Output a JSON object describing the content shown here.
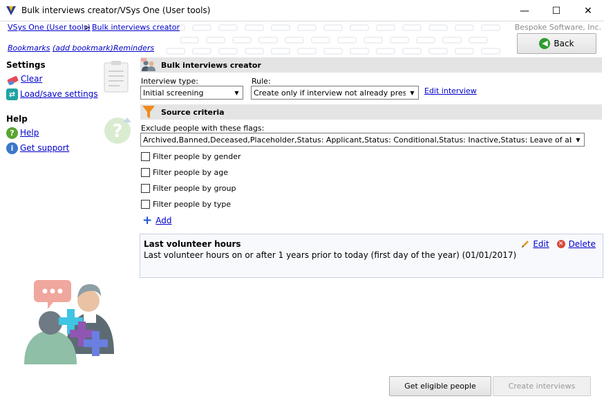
{
  "window": {
    "title": "Bulk interviews creator/VSys One (User tools)",
    "minimize": "—",
    "maximize": "☐",
    "close": "✕"
  },
  "breadcrumb": {
    "home": "VSys One (User tools)",
    "separator": ">",
    "current": "Bulk interviews creator"
  },
  "company": "Bespoke Software, Inc.",
  "back_label": "Back",
  "top_links": {
    "bookmarks": "Bookmarks",
    "add_bookmark": "(add bookmark)",
    "reminders": "Reminders"
  },
  "sidebar": {
    "settings_heading": "Settings",
    "clear": "Clear",
    "load_save": "Load/save settings",
    "help_heading": "Help",
    "help": "Help",
    "support": "Get support"
  },
  "creator": {
    "section_title": "Bulk interviews creator",
    "interview_type_label": "Interview type:",
    "interview_type_value": "Initial screening",
    "rule_label": "Rule:",
    "rule_value": "Create only if interview not already present",
    "edit_interview": "Edit interview"
  },
  "criteria": {
    "section_title": "Source criteria",
    "exclude_label": "Exclude people with these flags:",
    "exclude_value": "Archived,Banned,Deceased,Placeholder,Status: Applicant,Status: Conditional,Status: Inactive,Status: Leave of absence,Status:",
    "filters": [
      "Filter people by gender",
      "Filter people by age",
      "Filter people by group",
      "Filter people by type"
    ],
    "add_label": "Add",
    "item": {
      "title": "Last volunteer hours",
      "description": "Last volunteer hours on or after 1 years  prior to today (first day of the year) (01/01/2017)",
      "edit": "Edit",
      "delete": "Delete"
    }
  },
  "buttons": {
    "get_eligible": "Get eligible people",
    "create": "Create interviews"
  },
  "colors": {
    "section_bg": "#e4e4e4",
    "link": "#0000cc",
    "accent_green": "#2e9c2e"
  }
}
